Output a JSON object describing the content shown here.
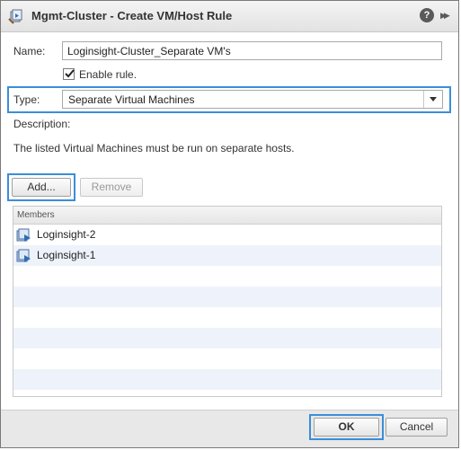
{
  "dialog": {
    "title": "Mgmt-Cluster - Create VM/Host Rule",
    "help_label": "?",
    "expand_label": "▶▶"
  },
  "form": {
    "name_label": "Name:",
    "name_value": "Loginsight-Cluster_Separate VM's",
    "enable_label": "Enable rule.",
    "enable_checked": true,
    "type_label": "Type:",
    "type_value": "Separate Virtual Machines",
    "description_label": "Description:",
    "description_text": "The listed Virtual Machines must be run on separate hosts."
  },
  "toolbar": {
    "add_label": "Add...",
    "remove_label": "Remove"
  },
  "members": {
    "header": "Members",
    "rows": [
      {
        "name": "Loginsight-2"
      },
      {
        "name": "Loginsight-1"
      }
    ]
  },
  "footer": {
    "ok_label": "OK",
    "cancel_label": "Cancel"
  },
  "colors": {
    "focus_highlight": "#3b8ed8",
    "row_alt": "#eef3fb"
  },
  "icons": {
    "title": "vm-host-rule-icon",
    "member": "virtual-machine-icon"
  }
}
